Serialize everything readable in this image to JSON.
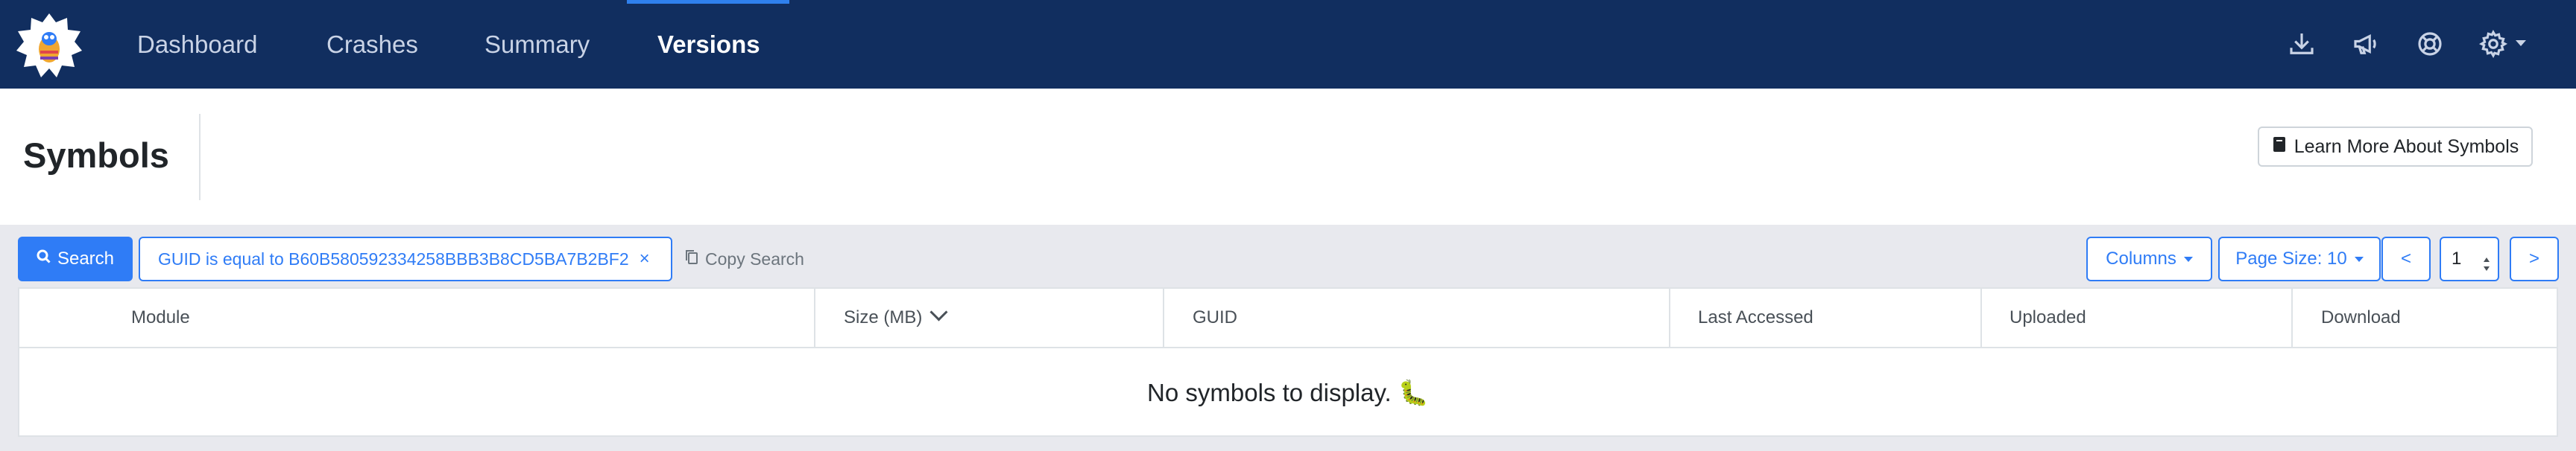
{
  "navbar": {
    "items": [
      {
        "label": "Dashboard"
      },
      {
        "label": "Crashes"
      },
      {
        "label": "Summary"
      },
      {
        "label": "Versions"
      }
    ],
    "active": "Versions",
    "icons": [
      "download-icon",
      "megaphone-icon",
      "lifebuoy-icon",
      "gear-icon"
    ]
  },
  "header": {
    "title": "Symbols",
    "learn_more_label": "Learn More About Symbols"
  },
  "toolbar": {
    "search_label": "Search",
    "filter_chip": "GUID is equal to B60B580592334258BBB3B8CD5BA7B2BF2",
    "filter_close": "×",
    "copy_search_label": "Copy Search",
    "columns_label": "Columns",
    "page_size_label": "Page Size: 10",
    "prev_label": "<",
    "page_value": "1",
    "next_label": ">"
  },
  "table": {
    "columns": [
      "Module",
      "Size (MB)",
      "GUID",
      "Last Accessed",
      "Uploaded",
      "Download"
    ],
    "sorted_column": "Size (MB)",
    "empty_message": "No symbols to display. 🐛"
  },
  "colors": {
    "navbar": "#112e5f",
    "accent": "#2f7cf6",
    "page_bg": "#e8e9ee"
  }
}
